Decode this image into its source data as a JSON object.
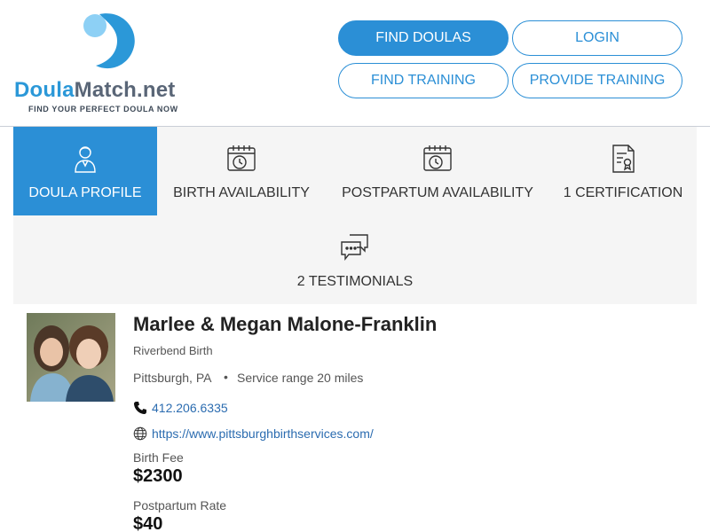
{
  "logo": {
    "word_part1": "Doula",
    "word_part2": "Match.net",
    "tagline": "FIND YOUR PERFECT DOULA NOW",
    "icon": "doula-match-logo-mark"
  },
  "nav": {
    "find_doulas": "FIND DOULAS",
    "login": "LOGIN",
    "find_training": "FIND TRAINING",
    "provide_training": "PROVIDE TRAINING"
  },
  "tabs": [
    {
      "label": "DOULA PROFILE",
      "icon": "person-icon",
      "active": true
    },
    {
      "label": "BIRTH AVAILABILITY",
      "icon": "calendar-clock-icon",
      "active": false
    },
    {
      "label": "POSTPARTUM AVAILABILITY",
      "icon": "calendar-clock-icon",
      "active": false
    },
    {
      "label": "1 CERTIFICATION",
      "icon": "certificate-icon",
      "active": false
    },
    {
      "label": "2 TESTIMONIALS",
      "icon": "chat-bubbles-icon",
      "active": false
    }
  ],
  "profile": {
    "name": "Marlee & Megan Malone-Franklin",
    "organization": "Riverbend Birth",
    "location": "Pittsburgh, PA",
    "separator": "•",
    "service_range": "Service range 20 miles",
    "phone": "412.206.6335",
    "website": "https://www.pittsburghbirthservices.com/",
    "birth_fee_label": "Birth Fee",
    "birth_fee": "$2300",
    "postpartum_rate_label": "Postpartum Rate",
    "postpartum_rate": "$40"
  },
  "colors": {
    "brand_blue": "#2b8fd6",
    "logo_blue": "#2b98d8",
    "link_blue": "#2b6cb0",
    "tab_bg": "#f5f5f5"
  }
}
